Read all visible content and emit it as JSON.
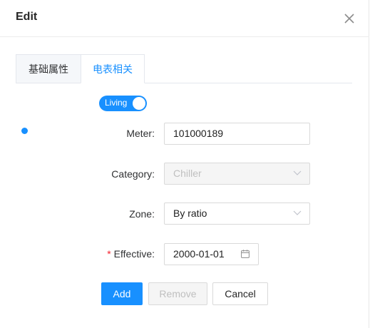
{
  "dialog": {
    "title": "Edit"
  },
  "tabs": [
    {
      "label": "基础属性",
      "active": false
    },
    {
      "label": "电表相关",
      "active": true
    }
  ],
  "status_switch": {
    "label": "Living",
    "on": true
  },
  "form": {
    "meter": {
      "label": "Meter",
      "value": "101000189"
    },
    "category": {
      "label": "Category",
      "value": "Chiller",
      "disabled": true
    },
    "zone": {
      "label": "Zone",
      "value": "By ratio"
    },
    "effective": {
      "label": "Effective",
      "required_mark": "*",
      "value": "2000-01-01"
    }
  },
  "buttons": {
    "add": "Add",
    "remove": "Remove",
    "cancel": "Cancel"
  },
  "colors": {
    "accent": "#1890ff",
    "required": "#f5222d",
    "disabled_bg": "#f5f5f5"
  }
}
